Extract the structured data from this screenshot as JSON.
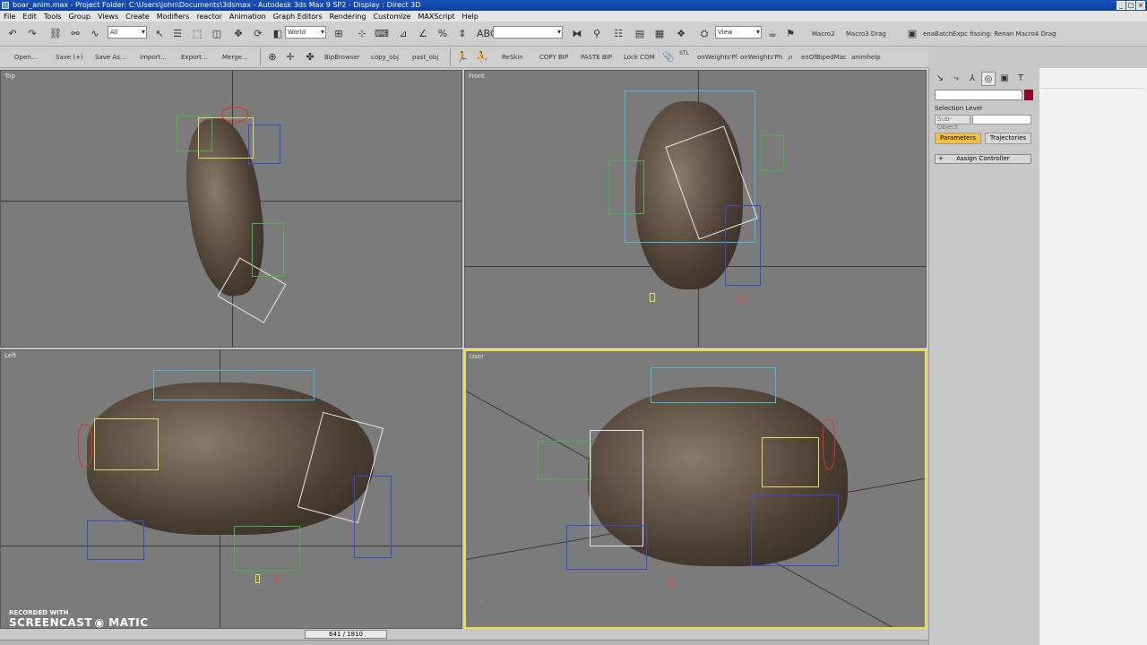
{
  "window": {
    "title": "boar_anim.max     - Project Folder: C:\\Users\\john\\Documents\\3dsmax     - Autodesk 3ds Max 9 SP2     - Display : Direct 3D"
  },
  "menu": [
    "File",
    "Edit",
    "Tools",
    "Group",
    "Views",
    "Create",
    "Modifiers",
    "reactor",
    "Animation",
    "Graph Editors",
    "Rendering",
    "Customize",
    "MAXScript",
    "Help"
  ],
  "toolbar1": {
    "selection_filter": "All",
    "ref_coord": "World",
    "named_sel": "",
    "view_drop": "View",
    "macros": [
      "Macro2",
      "Macro3 Drag",
      "enaBatchExpc fissing: Renan  Macro4 Drag"
    ]
  },
  "toolbar2": {
    "buttons": [
      "Open...",
      "Save (+)",
      "Save As...",
      "Import...",
      "Export...",
      "Merge..."
    ],
    "buttons2": [
      "BipBrowser",
      "copy_obj",
      "past_obj"
    ],
    "buttons3": [
      "ReSkin",
      "COPY BIP",
      "PASTE BIP",
      "Lock COM"
    ],
    "buttons4": [
      "onWeights'Pl",
      "onWeights'Ph",
      "enOfBipedMac",
      "animhelp"
    ],
    "stl_label": "STL"
  },
  "viewports": {
    "top": "Top",
    "front": "Front",
    "left": "Left",
    "user": "User"
  },
  "command_panel": {
    "selection_level_label": "Selection Level",
    "sub_object_label": "Sub-Object",
    "tab_parameters": "Parameters",
    "tab_trajectories": "Trajectories",
    "rollout_assign": "Assign Controller",
    "rollout_plus": "+"
  },
  "status": {
    "frame_counter": "641 / 1810"
  },
  "watermark": {
    "line1": "RECORDED WITH",
    "line2": "SCREENCAST",
    "line3": "MATIC"
  },
  "colors": {
    "titlebar": "#1a52b8",
    "active_viewport_border": "#f0e040",
    "parameters_tab": "#f5c040",
    "object_color": "#8a0c2a"
  }
}
